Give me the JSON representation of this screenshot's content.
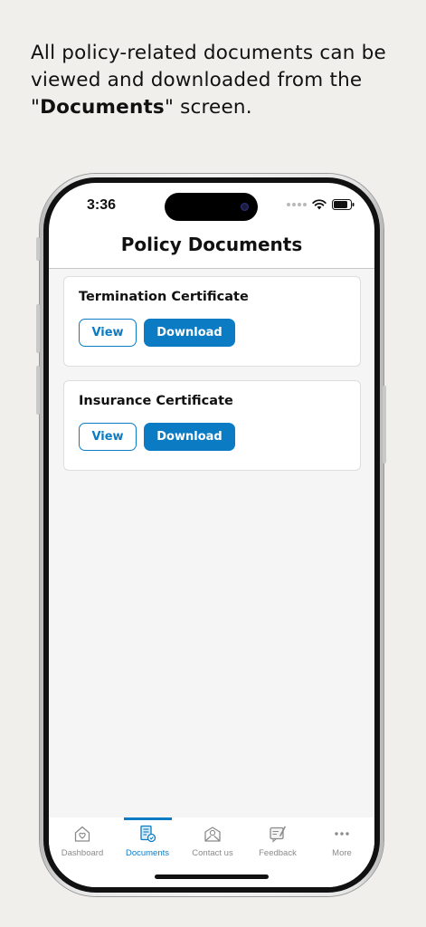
{
  "caption": {
    "part1": "All policy-related documents can be viewed and downloaded from the ",
    "quote_open": "\"",
    "bold": "Documents",
    "quote_close": "\"",
    "part2": " screen."
  },
  "status_bar": {
    "time": "3:36"
  },
  "nav": {
    "title": "Policy Documents"
  },
  "documents": [
    {
      "title": "Termination Certificate",
      "view_label": "View",
      "download_label": "Download"
    },
    {
      "title": "Insurance Certificate",
      "view_label": "View",
      "download_label": "Download"
    }
  ],
  "tabs": [
    {
      "label": "Dashboard",
      "icon": "home-heart-icon",
      "active": false
    },
    {
      "label": "Documents",
      "icon": "document-icon",
      "active": true
    },
    {
      "label": "Contact us",
      "icon": "envelope-icon",
      "active": false
    },
    {
      "label": "Feedback",
      "icon": "feedback-icon",
      "active": false
    },
    {
      "label": "More",
      "icon": "more-dots-icon",
      "active": false
    }
  ],
  "colors": {
    "accent": "#0b7cc4",
    "background": "#f0efec",
    "inactive_tab": "#8a8a8a"
  }
}
